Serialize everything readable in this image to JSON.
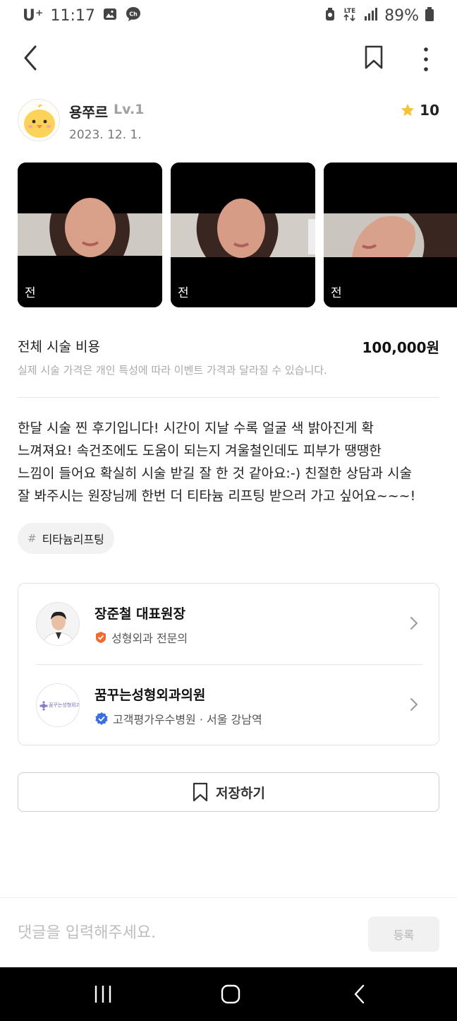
{
  "status_bar": {
    "carrier": "U⁺",
    "time": "11:17",
    "battery": "89%",
    "network_icon": "lte-icon",
    "signal_icon": "signal-icon"
  },
  "header": {
    "back_icon": "back-arrow-icon",
    "bookmark_icon": "bookmark-icon",
    "more_icon": "more-vertical-icon"
  },
  "author": {
    "name": "용쭈르",
    "level": "Lv.1",
    "date": "2023. 12. 1.",
    "rating": "10",
    "star_color": "#F5C431"
  },
  "photos": [
    {
      "label": "전"
    },
    {
      "label": "전"
    },
    {
      "label": "전"
    }
  ],
  "cost": {
    "label": "전체 시술 비용",
    "value": "100,000원",
    "note": "실제 시술 가격은 개인 특성에 따라 이벤트 가격과 달라질 수 있습니다."
  },
  "review": {
    "lines": [
      "한달 시술 찐 후기입니다! 시간이 지날 수록 얼굴 색 밝아진게 확",
      "느껴져요! 속건조에도 도움이 되는지 겨울철인데도 피부가 땡땡한",
      "느낌이 들어요 확실히 시술 받길 잘 한 것 같아요:-) 친절한 상담과 시술",
      "잘 봐주시는 원장님께 한번 더 티타늄 리프팅 받으러 가고 싶어요~~~!"
    ]
  },
  "tag": {
    "hash": "#",
    "label": "티타늄리프팅"
  },
  "doctor": {
    "name": "장준철 대표원장",
    "specialty": "성형외과 전문의",
    "badge_color": "#F26B2E"
  },
  "clinic": {
    "name": "꿈꾸는성형외과의원",
    "logo_text": "꿈꾸는성형외과",
    "info": "고객평가우수병원 · 서울 강남역",
    "badge_color": "#3B6FE0"
  },
  "save_button": {
    "label": "저장하기"
  },
  "comment": {
    "placeholder": "댓글을 입력해주세요.",
    "submit_label": "등록"
  }
}
